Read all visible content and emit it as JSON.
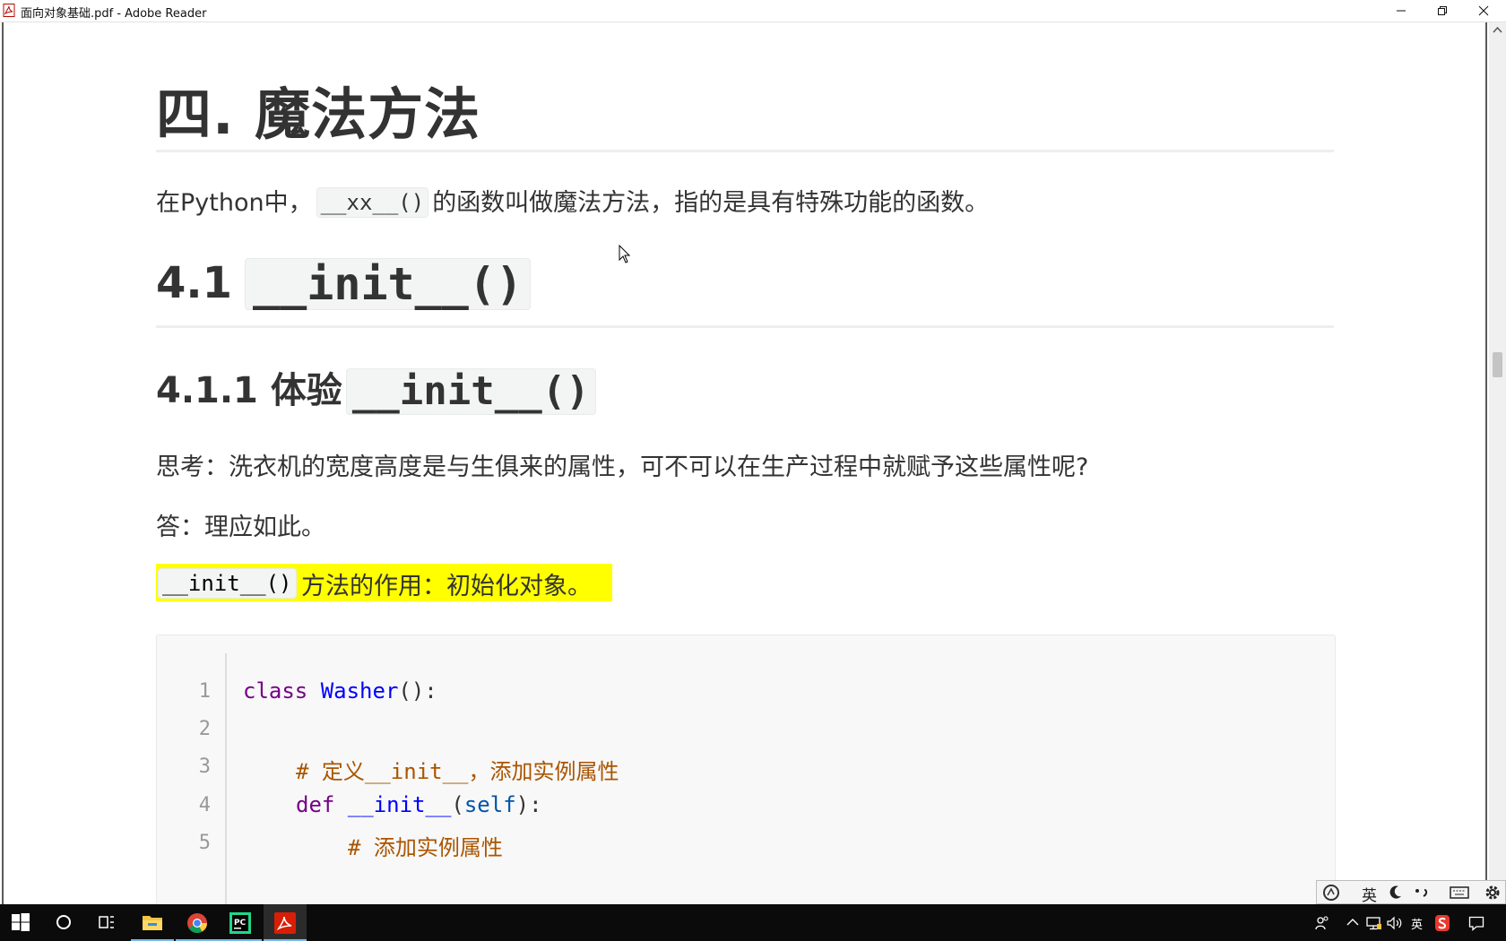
{
  "window": {
    "title": "面向对象基础.pdf - Adobe Reader",
    "icons": [
      "pdf-file-icon",
      "minimize-icon",
      "restore-icon",
      "close-icon"
    ]
  },
  "document": {
    "heading1": "四. 魔法方法",
    "intro": {
      "before": "在Python中，",
      "code": "__xx__()",
      "after": "的函数叫做魔法方法，指的是具有特殊功能的函数。"
    },
    "heading2": {
      "number": "4.1",
      "code": "__init__()"
    },
    "heading3": {
      "text": "4.1.1 体验",
      "code": "__init__()"
    },
    "think": "思考：洗衣机的宽度高度是与生俱来的属性，可不可以在生产过程中就赋予这些属性呢?",
    "answer": "答：理应如此。",
    "highlight": {
      "code": "__init__()",
      "text": "方法的作用：初始化对象。"
    },
    "code_lines": [
      {
        "n": "1",
        "kw": "class ",
        "name": "Washer",
        "rest": "():"
      },
      {
        "n": "2"
      },
      {
        "n": "3",
        "comment": "# 定义__init__，添加实例属性"
      },
      {
        "n": "4",
        "kw": "def ",
        "name": "__init__",
        "open": "(",
        "self": "self",
        "rest": "):"
      },
      {
        "n": "5",
        "comment": "# 添加实例属性"
      }
    ]
  },
  "ime_toolbar": {
    "lang": "英",
    "icons": [
      "ime-logo-icon",
      "moon-icon",
      "punctuation-icon",
      "keyboard-icon",
      "settings-gear-icon"
    ]
  },
  "taskbar": {
    "apps": [
      "windows-start-icon",
      "cortana-search-icon",
      "task-view-icon",
      "file-explorer-icon",
      "chrome-icon",
      "pycharm-icon",
      "adobe-reader-icon"
    ],
    "tray_lang": "英",
    "tray_icons": [
      "people-icon",
      "chevron-up-icon",
      "network-icon",
      "volume-icon",
      "sogou-icon",
      "notification-icon"
    ]
  },
  "colors": {
    "highlight": "#ffff00",
    "code_keyword": "#770088",
    "code_def": "#0000ff",
    "code_comment": "#aa5500",
    "code_variable": "#0055aa"
  }
}
